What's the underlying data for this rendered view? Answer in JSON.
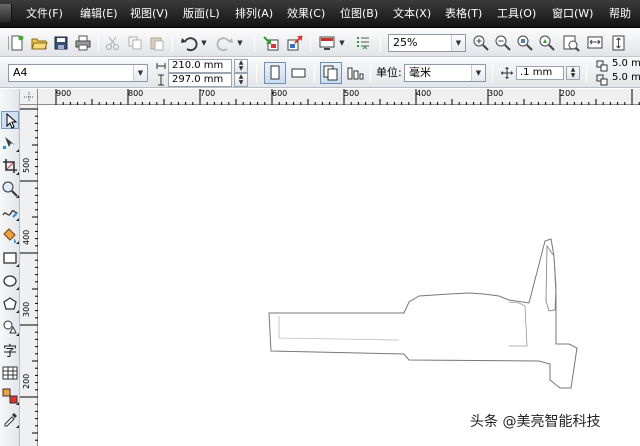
{
  "menu": {
    "items": [
      "文件(F)",
      "编辑(E)",
      "视图(V)",
      "版面(L)",
      "排列(A)",
      "效果(C)",
      "位图(B)",
      "文本(X)",
      "表格(T)",
      "工具(O)",
      "窗口(W)",
      "帮助"
    ]
  },
  "toolbar": {
    "zoom_value": "25%"
  },
  "property_bar": {
    "page_size": "A4",
    "width": "210.0 mm",
    "height": "297.0 mm",
    "units_label": "单位:",
    "units_value": "毫米",
    "nudge": ".1 mm",
    "dup_x": "5.0 mm",
    "dup_y": "5.0 mm"
  },
  "rulers": {
    "horizontal": [
      "900",
      "800",
      "700",
      "600",
      "500",
      "400",
      "300",
      "200"
    ],
    "vertical": [
      "500",
      "400",
      "300",
      "200"
    ]
  },
  "icons": {
    "toolbar": [
      "new-document-icon",
      "open-folder-icon",
      "save-icon",
      "print-icon",
      "cut-icon",
      "copy-icon",
      "paste-icon",
      "undo-icon",
      "redo-icon",
      "import-icon",
      "export-icon",
      "application-launcher-icon",
      "welcome-screen-icon",
      "zoom-in-icon",
      "zoom-out-icon",
      "zoom-selected-icon",
      "zoom-all-icon",
      "zoom-page-icon",
      "zoom-width-icon",
      "zoom-height-icon"
    ],
    "toolbox": [
      "pick-tool-icon",
      "shape-tool-icon",
      "crop-tool-icon",
      "zoom-tool-icon",
      "freehand-tool-icon",
      "smart-fill-icon",
      "rectangle-tool-icon",
      "ellipse-tool-icon",
      "polygon-tool-icon",
      "basic-shapes-icon",
      "text-tool-icon",
      "table-tool-icon",
      "interactive-blend-icon",
      "eyedropper-icon"
    ]
  },
  "watermark": "头条 @美亮智能科技"
}
